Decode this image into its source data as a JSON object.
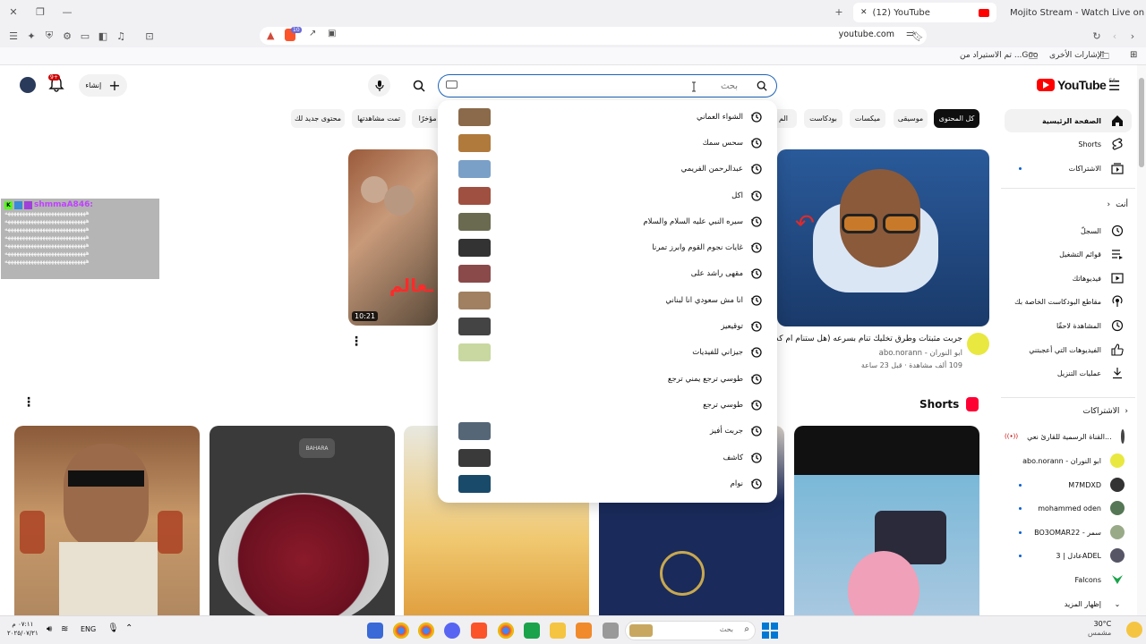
{
  "browser": {
    "tabs": [
      {
        "title": "Mojito Stream - Watch Live on Kick"
      },
      {
        "title": "(12) YouTube"
      }
    ],
    "address": "youtube.com",
    "bookmarks": {
      "other": "الإشارات الأخرى",
      "imported": "تم الاستيراد من ...Goo"
    },
    "colors": {
      "brand": "#ff0000",
      "accent": "#065fd4",
      "kick": "#53fc18"
    }
  },
  "header": {
    "logo_text": "YouTube",
    "region": "SA",
    "search_placeholder": "بحث",
    "create_label": "إنشاء",
    "notif_count": "9+"
  },
  "chips": [
    "كل المحتوى",
    "موسيقى",
    "ميكسات",
    "بودكاست",
    "الم",
    "ا مؤخرًا",
    "تمت مشاهدتها",
    "محتوى جديد لك"
  ],
  "sidebar": {
    "main": [
      {
        "label": "الصفحة الرئيسية",
        "icon": "home-icon"
      },
      {
        "label": "Shorts",
        "icon": "shorts-icon"
      },
      {
        "label": "الاشتراكات",
        "icon": "subscriptions-icon"
      }
    ],
    "you_title": "أنت",
    "you": [
      {
        "label": "السجلّ",
        "icon": "history-icon"
      },
      {
        "label": "قوائم التشغيل",
        "icon": "playlist-icon"
      },
      {
        "label": "فيديوهاتك",
        "icon": "your-videos-icon"
      },
      {
        "label": "مقاطع البودكاست الخاصة بك",
        "icon": "podcast-icon"
      },
      {
        "label": "المشاهدة لاحقًا",
        "icon": "clock-icon"
      },
      {
        "label": "الفيديوهات التي أعجبتني",
        "icon": "like-icon"
      },
      {
        "label": "عمليات التنزيل",
        "icon": "download-icon"
      }
    ],
    "subs_title": "الاشتراكات",
    "subs": [
      {
        "label": "القناة الرسمية للقارئ نعي...",
        "color": "#444"
      },
      {
        "label": "abo.norann - ابو النوران",
        "color": "#e8e840"
      },
      {
        "label": "M7MDXD",
        "color": "#333"
      },
      {
        "label": "mohammed oden",
        "color": "#557755"
      },
      {
        "label": "BO3OMAR22 - سمر",
        "color": "#99aa88"
      },
      {
        "label": "عادل | 3ADEL",
        "color": "#556"
      },
      {
        "label": "Falcons",
        "color": "#1aa34a"
      },
      {
        "label": "إظهار المزيد",
        "color": ""
      }
    ]
  },
  "dropdown": {
    "items": [
      {
        "text": "الشواء العماني",
        "thumb": "#8a6a4a"
      },
      {
        "text": "سحس سمك",
        "thumb": "#b07a3c"
      },
      {
        "text": "عبدالرحمن الفريمي",
        "thumb": "#7aa0c8"
      },
      {
        "text": "اكل",
        "thumb": "#a05040"
      },
      {
        "text": "سيره النبي عليه السلام والسلام",
        "thumb": "#6a6a50"
      },
      {
        "text": "غايات نجوم القوم وابرز تمرنا",
        "thumb": "#333"
      },
      {
        "text": "مقهى راشد على",
        "thumb": "#8a4a4a"
      },
      {
        "text": "انا مش سعودي انا لبناني",
        "thumb": "#a08060"
      },
      {
        "text": "توقيعيز",
        "thumb": "#444"
      },
      {
        "text": "جيزاني للفيديات",
        "thumb": "#c8d8a0"
      },
      {
        "text": "طوسي ترجع يمني ترجع",
        "thumb": ""
      },
      {
        "text": "طوسي ترجع",
        "thumb": ""
      },
      {
        "text": "جربت أفيز",
        "thumb": "#556677"
      },
      {
        "text": "كاشف",
        "thumb": "#3a3a3a"
      },
      {
        "text": "نوام",
        "thumb": "#1a4a6a"
      }
    ]
  },
  "video": {
    "title": "جربت مثبتات وطرق تخليك تنام بسرعه (هل ستنام ام كذ",
    "channel": "ابو النوران - abo.norann",
    "meta": "109 ألف مشاهدة · قبل 23 ساعة",
    "duration": "10:21"
  },
  "shorts_title": "Shorts",
  "chat": {
    "user": "shmmaA846:",
    "line": "ههههههههههههههههههههههههههههه"
  },
  "taskbar": {
    "weather_temp": "30°C",
    "weather_desc": "مشمس",
    "lang": "ENG",
    "time": "٠٧:١١ م",
    "date": "٢٠٢٥/٠٧/٢١",
    "search_placeholder": "بحث"
  }
}
